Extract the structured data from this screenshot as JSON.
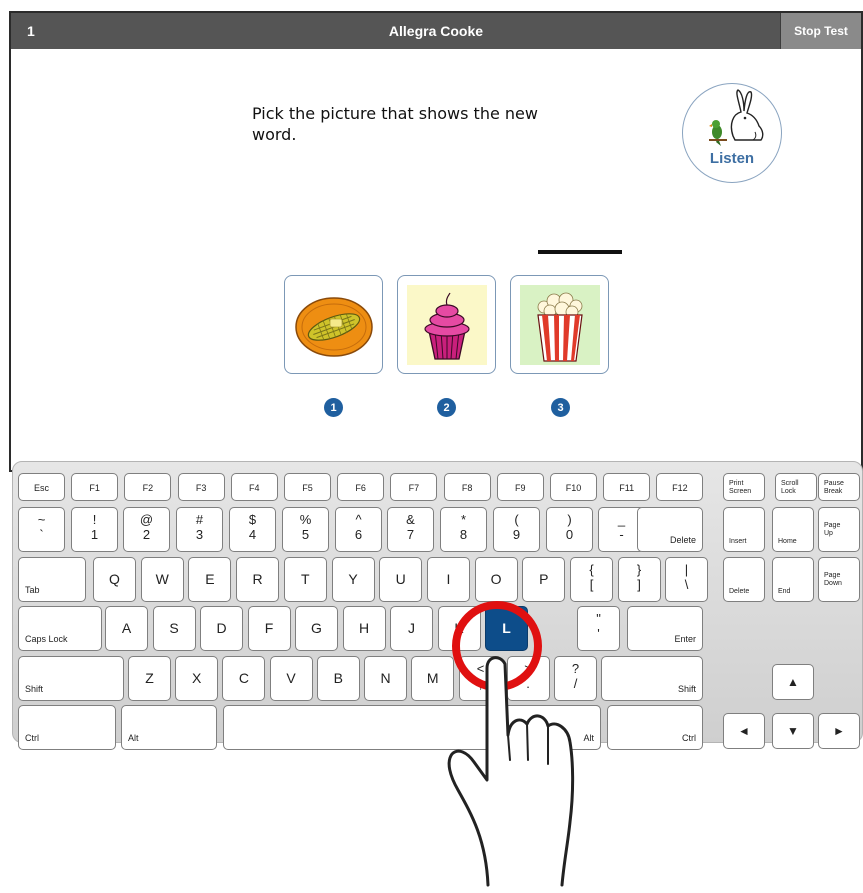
{
  "header": {
    "item_number": "1",
    "student_name": "Allegra Cooke",
    "stop_label": "Stop Test"
  },
  "prompt": "Pick the picture that shows the new word.",
  "listen_label": "Listen",
  "choices": [
    {
      "number": "1",
      "picture": "corn-on-plate"
    },
    {
      "number": "2",
      "picture": "cupcake"
    },
    {
      "number": "3",
      "picture": "popcorn"
    }
  ],
  "keyboard": {
    "row1": [
      "Esc",
      "F1",
      "F2",
      "F3",
      "F4",
      "F5",
      "F6",
      "F7",
      "F8",
      "F9",
      "F10",
      "F11",
      "F12"
    ],
    "row2": [
      [
        "~",
        "`"
      ],
      [
        "!",
        "1"
      ],
      [
        "@",
        "2"
      ],
      [
        "#",
        "3"
      ],
      [
        "$",
        "4"
      ],
      [
        "%",
        "5"
      ],
      [
        "^",
        "6"
      ],
      [
        "&",
        "7"
      ],
      [
        "*",
        "8"
      ],
      [
        "(",
        "9"
      ],
      [
        ")",
        "0"
      ],
      [
        "_",
        "-"
      ],
      [
        "+",
        "="
      ]
    ],
    "row3": [
      "Q",
      "W",
      "E",
      "R",
      "T",
      "Y",
      "U",
      "I",
      "O",
      "P"
    ],
    "row3_extra": [
      [
        "{",
        "["
      ],
      [
        "}",
        "]"
      ],
      [
        "|",
        "\\"
      ]
    ],
    "row4": [
      "A",
      "S",
      "D",
      "F",
      "G",
      "H",
      "J",
      "K",
      "L"
    ],
    "row4_extra": [
      [
        "\"",
        "'"
      ]
    ],
    "row5": [
      "Z",
      "X",
      "C",
      "V",
      "B",
      "N",
      "M"
    ],
    "row5_extra": [
      [
        "<",
        ","
      ],
      [
        ">",
        "."
      ],
      [
        "?",
        "/"
      ]
    ],
    "mods": {
      "tab": "Tab",
      "caps": "Caps Lock",
      "shift": "Shift",
      "ctrl": "Ctrl",
      "alt": "Alt",
      "delete": "Delete",
      "enter": "Enter"
    },
    "nav": {
      "print": "Print\nScreen",
      "scroll": "Scroll\nLock",
      "pause": "Pause\nBreak",
      "insert": "Insert",
      "home": "Home",
      "pgup": "Page\nUp",
      "delete": "Delete",
      "end": "End",
      "pgdn": "Page\nDown"
    },
    "arrows": [
      "▲",
      "◄",
      "▼",
      "►"
    ],
    "highlighted_key": "L"
  },
  "colors": {
    "highlight_ring": "#e01010",
    "highlight_key": "#0d4d8a",
    "titlebar": "#555555",
    "number_badge": "#1f5f9f"
  }
}
